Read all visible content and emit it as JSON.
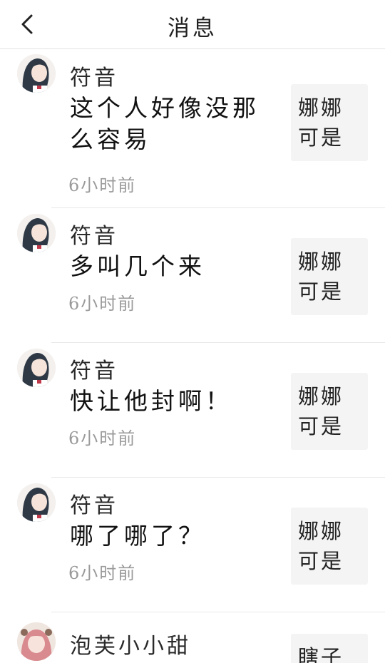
{
  "header": {
    "title": "消息",
    "back_icon": "chevron-left-icon"
  },
  "messages": [
    {
      "name": "符音",
      "text": "这个人好像没那么容易",
      "time": "6小时前",
      "thumb_text": "娜娜可是",
      "avatar": "anime-girl-avatar"
    },
    {
      "name": "符音",
      "text": "多叫几个来",
      "time": "6小时前",
      "thumb_text": "娜娜可是",
      "avatar": "anime-girl-avatar"
    },
    {
      "name": "符音",
      "text": "快让他封啊！",
      "time": "6小时前",
      "thumb_text": "娜娜可是",
      "avatar": "anime-girl-avatar"
    },
    {
      "name": "符音",
      "text": "哪了哪了？",
      "time": "6小时前",
      "thumb_text": "娜娜可是",
      "avatar": "anime-girl-avatar"
    }
  ],
  "partial_message": {
    "name": "泡芙小小甜",
    "thumb_text": "瞎子",
    "avatar": "pink-hair-avatar"
  }
}
